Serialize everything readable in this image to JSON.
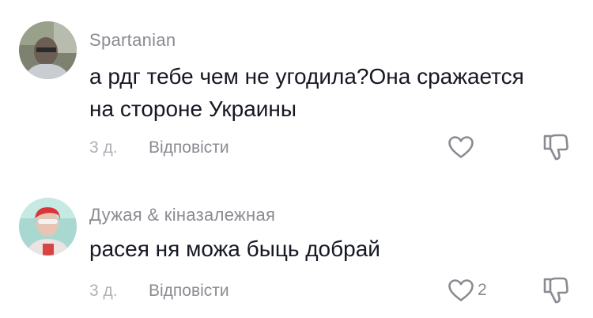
{
  "comments": [
    {
      "username": "Spartanian",
      "text": "а рдг тебе чем не угодила?Она сражается\nна стороне Украины",
      "time": "3 д.",
      "reply_label": "Відповісти",
      "like_count": "",
      "avatar_icon": "user-avatar-photo"
    },
    {
      "username": "Дужая & кіназалежная",
      "text": "расея ня можа быць добрай",
      "time": "3 д.",
      "reply_label": "Відповісти",
      "like_count": "2",
      "avatar_icon": "user-avatar-photo"
    }
  ],
  "colors": {
    "text": "#161823",
    "secondary": "#8a8b91",
    "muted": "#b0b1b6"
  }
}
